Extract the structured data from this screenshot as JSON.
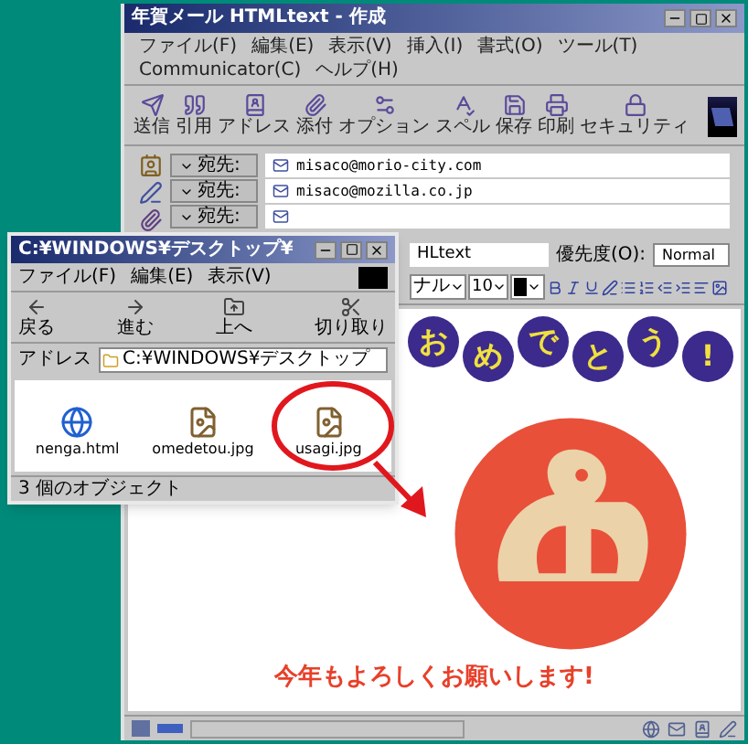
{
  "compose_window": {
    "title": "年賀メール HTMLtext - 作成",
    "menu": [
      "ファイル(F)",
      "編集(E)",
      "表示(V)",
      "挿入(I)",
      "書式(O)",
      "ツール(T)",
      "Communicator(C)",
      "ヘルプ(H)"
    ],
    "toolbar": [
      {
        "label": "送信",
        "kind": "send"
      },
      {
        "label": "引用",
        "kind": "quote"
      },
      {
        "label": "アドレス",
        "kind": "address"
      },
      {
        "label": "添付",
        "kind": "attach"
      },
      {
        "label": "オプション",
        "kind": "options"
      },
      {
        "label": "スペル",
        "kind": "spell"
      },
      {
        "label": "保存",
        "kind": "save"
      },
      {
        "label": "印刷",
        "kind": "print"
      },
      {
        "label": "セキュリティ",
        "kind": "security"
      }
    ],
    "recipients": [
      {
        "field": "宛先:",
        "address": "misaco@morio-city.com"
      },
      {
        "field": "宛先:",
        "address": "misaco@mozilla.co.jp"
      },
      {
        "field": "宛先:"
      }
    ],
    "subject": "HLtext",
    "priority": {
      "label": "優先度(O):",
      "value": "Normal"
    },
    "format_bar": {
      "font": "ナル",
      "size": "10"
    },
    "body": {
      "greeting_chars": [
        "お",
        "め",
        "で",
        "と",
        "う",
        "!"
      ],
      "footer": "今年もよろしくお願いします!"
    }
  },
  "explorer_window": {
    "title": "C:¥WINDOWS¥デスクトップ¥",
    "menu": [
      "ファイル(F)",
      "編集(E)",
      "表示(V)"
    ],
    "toolbar": [
      {
        "label": "戻る",
        "kind": "back"
      },
      {
        "label": "進む",
        "kind": "forward"
      },
      {
        "label": "上へ",
        "kind": "up"
      },
      {
        "label": "切り取り",
        "kind": "cut"
      }
    ],
    "address": {
      "label": "アドレス",
      "value": "C:¥WINDOWS¥デスクトップ"
    },
    "files": [
      {
        "name": "nenga.html",
        "kind": "html"
      },
      {
        "name": "omedetou.jpg",
        "kind": "image"
      },
      {
        "name": "usagi.jpg",
        "kind": "image"
      }
    ],
    "status": "3 個のオブジェクト"
  }
}
